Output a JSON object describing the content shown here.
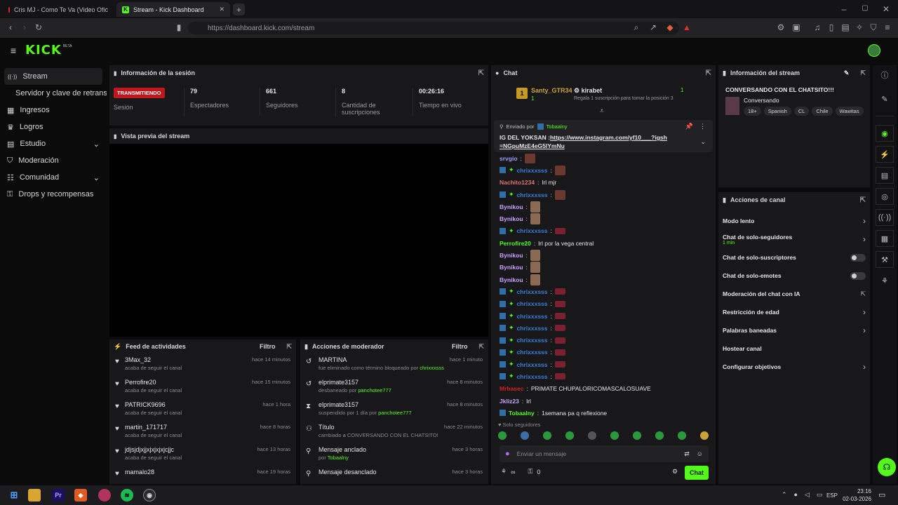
{
  "browser": {
    "tabs": [
      {
        "title": "Cris MJ - Como Te Va (Video Ofic",
        "active": false
      },
      {
        "title": "Stream - Kick Dashboard",
        "active": true
      }
    ],
    "url": "https://dashboard.kick.com/stream"
  },
  "app": {
    "logo": "KICK",
    "logo_tag": "BETA",
    "accent": "#53fc18"
  },
  "sidebar": {
    "items": [
      {
        "label": "Stream",
        "icon": "broadcast-icon"
      },
      {
        "label": "Servidor y clave de retransmisión",
        "icon": ""
      },
      {
        "label": "Ingresos",
        "icon": "grid-icon"
      },
      {
        "label": "Logros",
        "icon": "trophy-icon"
      },
      {
        "label": "Estudio",
        "icon": "layout-icon"
      },
      {
        "label": "Moderación",
        "icon": "shield-icon"
      },
      {
        "label": "Comunidad",
        "icon": "people-icon"
      },
      {
        "label": "Drops y recompensas",
        "icon": "gift-icon"
      }
    ]
  },
  "session": {
    "title": "Información de la sesión",
    "status": "TRANSMITIENDO",
    "stats": [
      {
        "value": "",
        "label": "Sesión"
      },
      {
        "value": "79",
        "label": "Espectadores"
      },
      {
        "value": "661",
        "label": "Seguidores"
      },
      {
        "value": "8",
        "label": "Cantidad de suscripciones"
      },
      {
        "value": "00:26:16",
        "label": "Tiempo en vivo"
      }
    ]
  },
  "preview": {
    "title": "Vista previa del stream"
  },
  "feed": {
    "title": "Feed de actividades",
    "filter": "Filtro",
    "rows": [
      {
        "name": "3Max_32",
        "sub": "acaba de seguir el canal",
        "time": "hace 14 minutos"
      },
      {
        "name": "Perrofire20",
        "sub": "acaba de seguir el canal",
        "time": "hace 15 minutos"
      },
      {
        "name": "PATRICK9696",
        "sub": "acaba de seguir el canal",
        "time": "hace 1 hora"
      },
      {
        "name": "martin_171717",
        "sub": "acaba de seguir el canal",
        "time": "hace 8 horas"
      },
      {
        "name": "jdjsjdjxjjxjxjxjxjcjjc",
        "sub": "acaba de seguir el canal",
        "time": "hace 13 horas"
      },
      {
        "name": "mamalo28",
        "sub": "",
        "time": "hace 19 horas"
      }
    ]
  },
  "modactions": {
    "title": "Acciones de moderador",
    "filter": "Filtro",
    "rows": [
      {
        "name": "MARTINA",
        "sub": "fue eliminado como término bloqueado por",
        "by": "chrixxxsss",
        "time": "hace 1 minuto"
      },
      {
        "name": "elprimate3157",
        "sub": "desbaneado por",
        "by": "panchotee777",
        "time": "hace 8 minutos"
      },
      {
        "name": "elprimate3157",
        "sub": "suspendido por 1 día por",
        "by": "panchotee777",
        "time": "hace 8 minutos"
      },
      {
        "name": "Título",
        "sub": "cambiado a CONVERSANDO CON EL CHATSITO!!! por",
        "by": "chrixxxsss",
        "time": "hace 22 minutos"
      },
      {
        "name": "Mensaje anclado",
        "sub": "por",
        "by": "Tobaalny",
        "time": "hace 3 horas"
      },
      {
        "name": "Mensaje desanclado",
        "sub": "",
        "by": "",
        "time": "hace 3 horas"
      }
    ]
  },
  "chat": {
    "title": "Chat",
    "top_user": "Santy_GTR34",
    "top_rank": "1",
    "top_count": "1",
    "kira": "kirabet",
    "kira_count": "1",
    "kira_sub": "Regala 1 suscripción para tomar la posición 3",
    "pinned_by_label": "Enviado por",
    "pinned_by": "Tobaalny",
    "pinned_text": "IG DEL YOKSAN :",
    "pinned_link": "https://www.instagram.com/yf10___?igsh=NGpuMzE4eG5lYmNu",
    "messages": [
      {
        "user": "srvgio",
        "color": "#9a9aff",
        "text": "",
        "emote": "emote"
      },
      {
        "user": "chrixxxsss",
        "color": "#3b7dd8",
        "badges": true,
        "text": "",
        "emote": "emote"
      },
      {
        "user": "Nachito1234",
        "color": "#e07070",
        "text": "lrl mjr"
      },
      {
        "user": "chrixxxsss",
        "color": "#3b7dd8",
        "badges": true,
        "text": "",
        "emote": "emote"
      },
      {
        "user": "Bynikou",
        "color": "#c9a0ff",
        "text": "",
        "emote": "face"
      },
      {
        "user": "Bynikou",
        "color": "#c9a0ff",
        "text": "",
        "emote": "face"
      },
      {
        "user": "chrixxxsss",
        "color": "#3b7dd8",
        "badges": true,
        "text": "",
        "emote": "small"
      },
      {
        "user": "Perrofire20",
        "color": "#53fc18",
        "text": "lrl por la vega central"
      },
      {
        "user": "Bynikou",
        "color": "#c9a0ff",
        "text": "",
        "emote": "face"
      },
      {
        "user": "Bynikou",
        "color": "#c9a0ff",
        "text": "",
        "emote": "face"
      },
      {
        "user": "Bynikou",
        "color": "#c9a0ff",
        "text": "",
        "emote": "face"
      },
      {
        "user": "chrixxxsss",
        "color": "#3b7dd8",
        "badges": true,
        "text": "",
        "emote": "small"
      },
      {
        "user": "chrixxxsss",
        "color": "#3b7dd8",
        "badges": true,
        "text": "",
        "emote": "small"
      },
      {
        "user": "chrixxxsss",
        "color": "#3b7dd8",
        "badges": true,
        "text": "",
        "emote": "small"
      },
      {
        "user": "chrixxxsss",
        "color": "#3b7dd8",
        "badges": true,
        "text": "",
        "emote": "small"
      },
      {
        "user": "chrixxxsss",
        "color": "#3b7dd8",
        "badges": true,
        "text": "",
        "emote": "small"
      },
      {
        "user": "chrixxxsss",
        "color": "#3b7dd8",
        "badges": true,
        "text": "",
        "emote": "small"
      },
      {
        "user": "chrixxxsss",
        "color": "#3b7dd8",
        "badges": true,
        "text": "",
        "emote": "small"
      },
      {
        "user": "chrixxxsss",
        "color": "#3b7dd8",
        "badges": true,
        "text": "",
        "emote": "small"
      },
      {
        "user": "Mrbasec",
        "color": "#d02020",
        "text": "PRIMATE CHUPALORICOMASCALOSUAVE"
      },
      {
        "user": "Jkliz23",
        "color": "#c9a0ff",
        "text": "lrl"
      },
      {
        "user": "Tobaalny",
        "color": "#53fc18",
        "badge_box": true,
        "text": "1semana pa q reflexione"
      }
    ],
    "mode_label": "Solo seguidores",
    "input_placeholder": "Enviar un mensaje",
    "infinity": "∞",
    "gift_count": "0",
    "send": "Chat"
  },
  "streaminfo": {
    "title": "Información del stream",
    "stream_title": "CONVERSANDO CON EL CHATSITO!!!",
    "category": "Conversando",
    "tags": [
      "18+",
      "Spanish",
      "CL",
      "Chile",
      "Wawitas"
    ]
  },
  "channelactions": {
    "title": "Acciones de canal",
    "items": [
      {
        "label": "Modo lento",
        "type": "chevron",
        "sub": ""
      },
      {
        "label": "Chat de solo-seguidores",
        "type": "chevron",
        "sub": "1 min"
      },
      {
        "label": "Chat de solo-suscriptores",
        "type": "toggle",
        "sub": ""
      },
      {
        "label": "Chat de solo-emotes",
        "type": "toggle",
        "sub": ""
      },
      {
        "label": "Moderación del chat con IA",
        "type": "external",
        "sub": ""
      },
      {
        "label": "Restricción de edad",
        "type": "chevron",
        "sub": ""
      },
      {
        "label": "Palabras baneadas",
        "type": "chevron",
        "sub": ""
      },
      {
        "label": "Hostear canal",
        "type": "none",
        "sub": ""
      },
      {
        "label": "Configurar objetivos",
        "type": "chevron",
        "sub": ""
      }
    ]
  },
  "taskbar": {
    "lang": "ESP",
    "time": "23:16",
    "date": "02-03-2026"
  }
}
